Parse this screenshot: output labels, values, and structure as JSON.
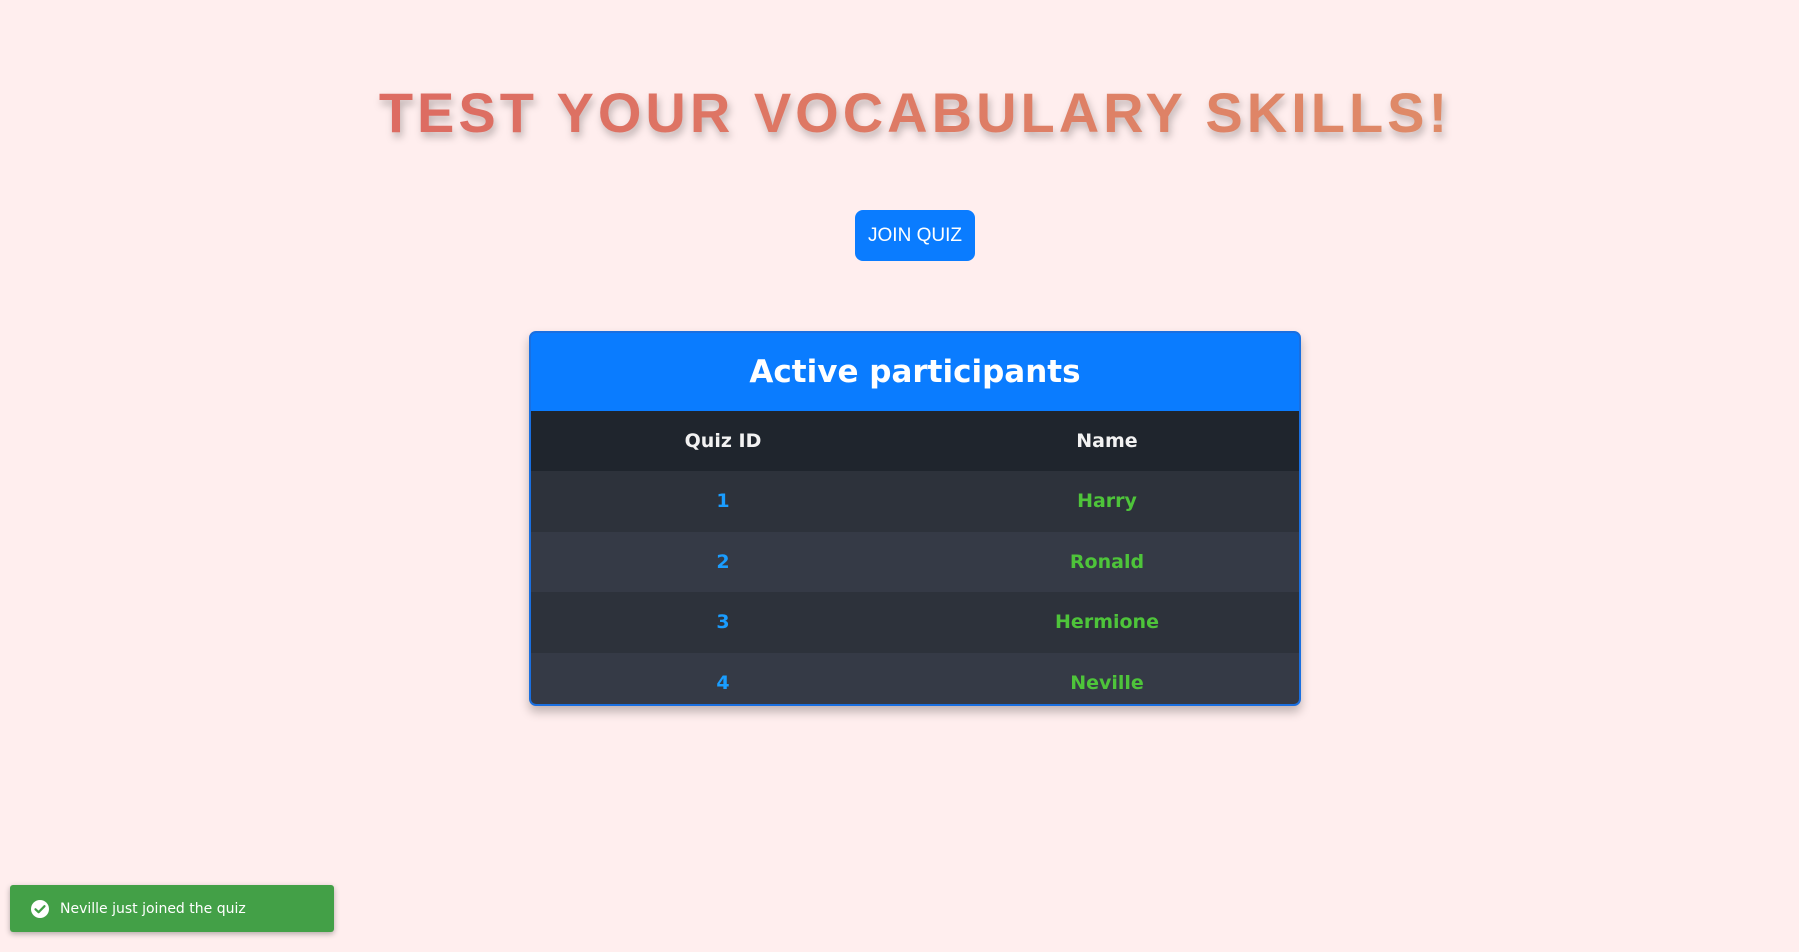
{
  "header": {
    "title": "TEST YOUR VOCABULARY SKILLS!"
  },
  "actions": {
    "join_label": "JOIN QUIZ"
  },
  "participants": {
    "title": "Active participants",
    "columns": [
      "Quiz ID",
      "Name"
    ],
    "rows": [
      {
        "id": "1",
        "name": "Harry"
      },
      {
        "id": "2",
        "name": "Ronald"
      },
      {
        "id": "3",
        "name": "Hermione"
      },
      {
        "id": "4",
        "name": "Neville"
      }
    ]
  },
  "toast": {
    "message": "Neville just joined the quiz",
    "icon": "check-circle-icon"
  },
  "colors": {
    "background": "#ffeeee",
    "accent": "#0a7cff",
    "id_text": "#1a9dff",
    "name_text": "#4ec43a",
    "toast_background": "#43a047"
  }
}
